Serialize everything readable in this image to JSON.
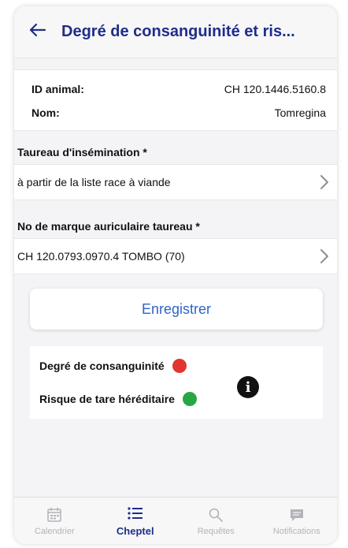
{
  "header": {
    "title": "Degré de consanguinité et ris...",
    "back_icon": "arrow-left-icon"
  },
  "animal": {
    "id_label": "ID animal:",
    "id_value": "CH 120.1446.5160.8",
    "name_label": "Nom:",
    "name_value": "Tomregina"
  },
  "insemination_bull": {
    "label": "Taureau d'insémination *",
    "value": "à partir de la liste race à viande"
  },
  "ear_tag": {
    "label": "No de marque auriculaire taureau *",
    "value": "CH 120.0793.0970.4 TOMBO (70)"
  },
  "save_button": {
    "label": "Enregistrer"
  },
  "results": {
    "inbreeding_label": "Degré de consanguinité",
    "inbreeding_status_color": "#e3342f",
    "hereditary_label": "Risque de tare héréditaire",
    "hereditary_status_color": "#27a744",
    "info_icon": "info-circle-icon"
  },
  "tabbar": {
    "tabs": [
      {
        "label": "Calendrier",
        "icon": "calendar-icon",
        "active": false
      },
      {
        "label": "Cheptel",
        "icon": "list-icon",
        "active": true
      },
      {
        "label": "Requêtes",
        "icon": "search-icon",
        "active": false
      },
      {
        "label": "Notifications",
        "icon": "message-icon",
        "active": false
      }
    ]
  },
  "colors": {
    "brand": "#1f2d8a",
    "link": "#2e63c9",
    "inactive": "#b4b4b8"
  }
}
